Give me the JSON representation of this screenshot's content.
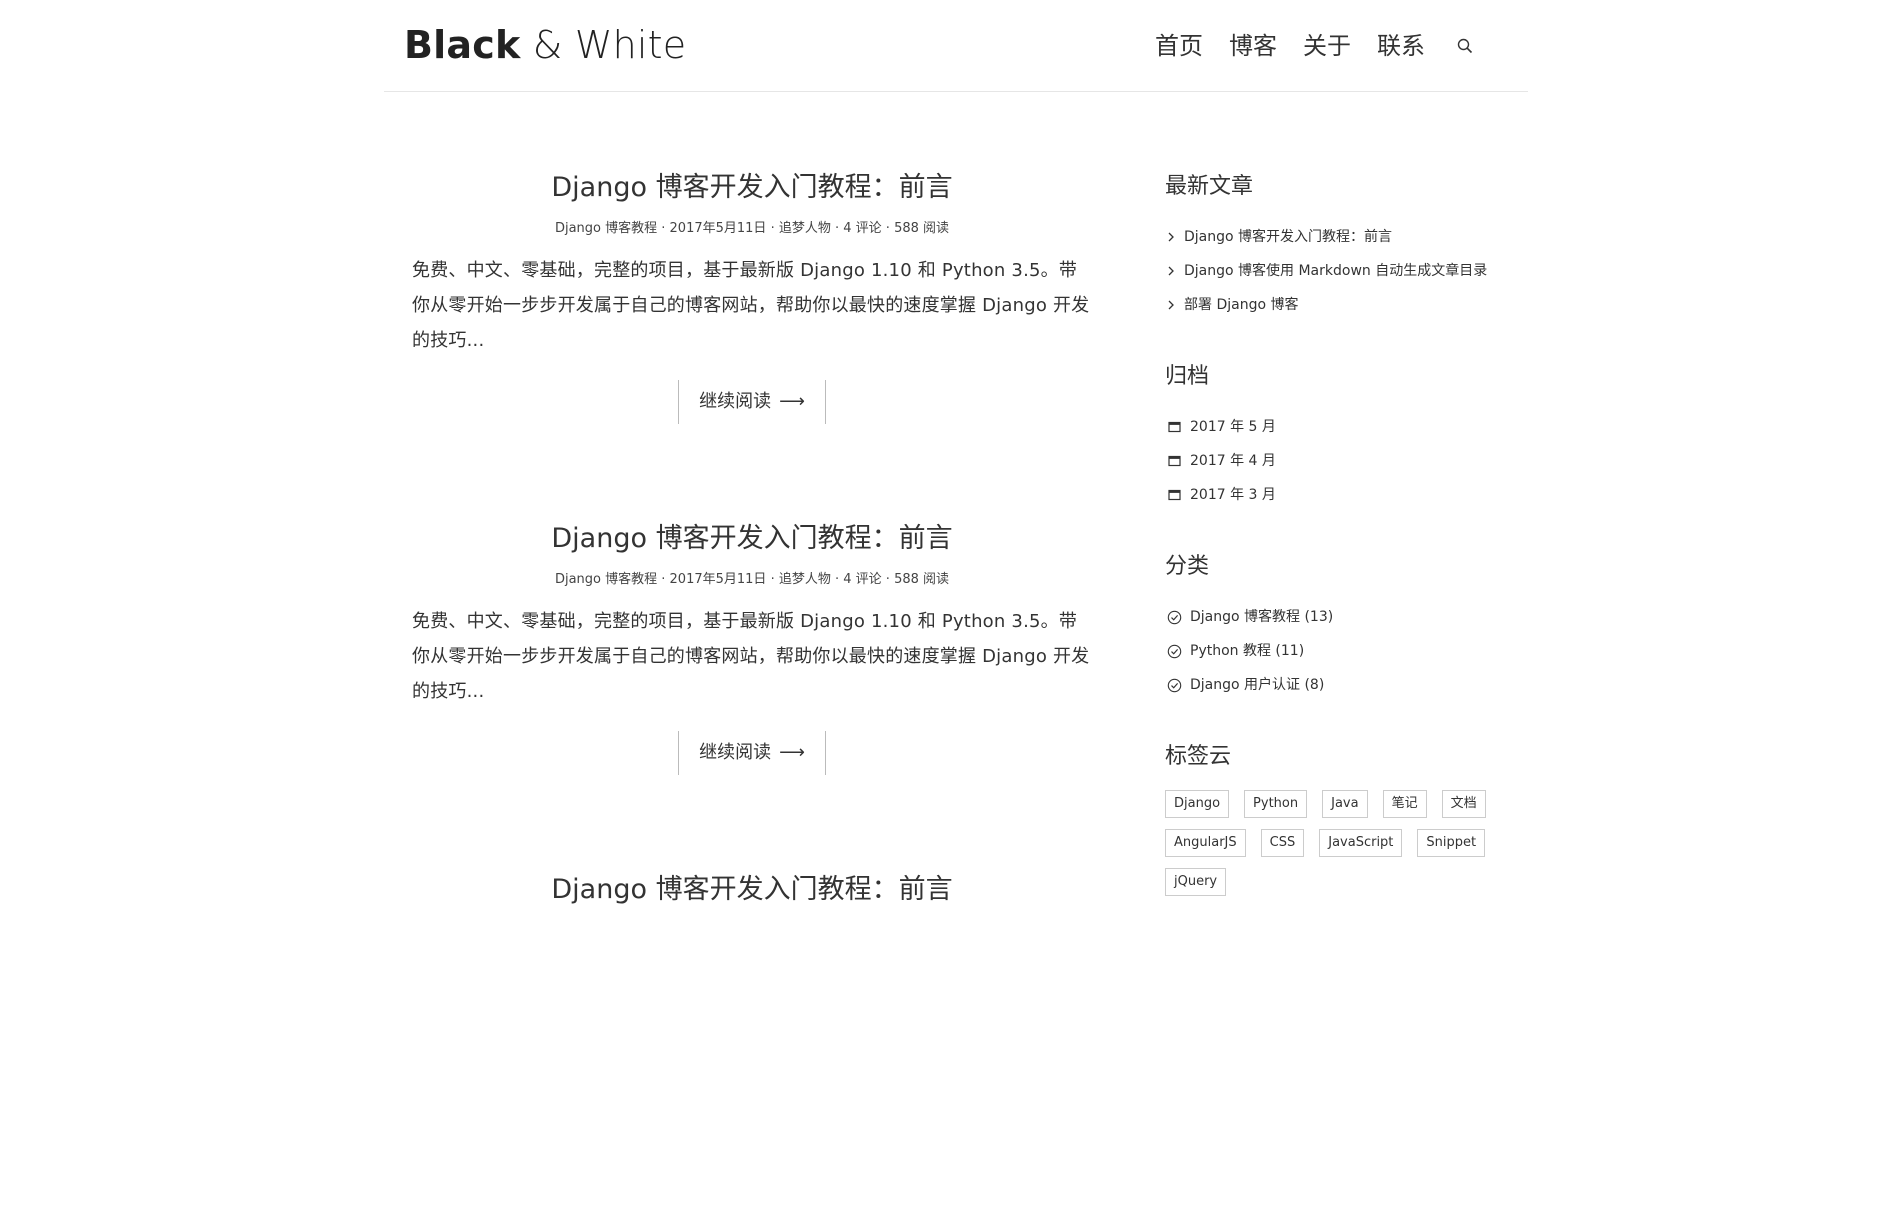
{
  "site": {
    "logo_strong": "Black",
    "logo_rest": " & White"
  },
  "nav": {
    "items": [
      "首页",
      "博客",
      "关于",
      "联系"
    ],
    "search_icon": "search-icon"
  },
  "posts": [
    {
      "title": "Django 博客开发入门教程：前言",
      "category": "Django 博客教程",
      "date": "2017年5月11日",
      "author": "追梦人物",
      "comments": "4 评论",
      "views": "588 阅读",
      "separator": " · ",
      "excerpt": "免费、中文、零基础，完整的项目，基于最新版 Django 1.10 和 Python 3.5。带你从零开始一步步开发属于自己的博客网站，帮助你以最快的速度掌握 Django 开发的技巧...",
      "more_label": "继续阅读",
      "more_arrow": "⟶"
    },
    {
      "title": "Django 博客开发入门教程：前言",
      "category": "Django 博客教程",
      "date": "2017年5月11日",
      "author": "追梦人物",
      "comments": "4 评论",
      "views": "588 阅读",
      "separator": " · ",
      "excerpt": "免费、中文、零基础，完整的项目，基于最新版 Django 1.10 和 Python 3.5。带你从零开始一步步开发属于自己的博客网站，帮助你以最快的速度掌握 Django 开发的技巧...",
      "more_label": "继续阅读",
      "more_arrow": "⟶"
    },
    {
      "title": "Django 博客开发入门教程：前言"
    }
  ],
  "sidebar": {
    "recent": {
      "title": "最新文章",
      "items": [
        "Django 博客开发入门教程：前言",
        "Django 博客使用 Markdown 自动生成文章目录",
        "部署 Django 博客"
      ]
    },
    "archive": {
      "title": "归档",
      "items": [
        "2017 年 5 月",
        "2017 年 4 月",
        "2017 年 3 月"
      ]
    },
    "categories": {
      "title": "分类",
      "items": [
        "Django 博客教程 (13)",
        "Python 教程 (11)",
        "Django 用户认证 (8)"
      ]
    },
    "tags": {
      "title": "标签云",
      "items": [
        "Django",
        "Python",
        "Java",
        "笔记",
        "文档",
        "AngularJS",
        "CSS",
        "JavaScript",
        "Snippet",
        "jQuery"
      ]
    }
  }
}
